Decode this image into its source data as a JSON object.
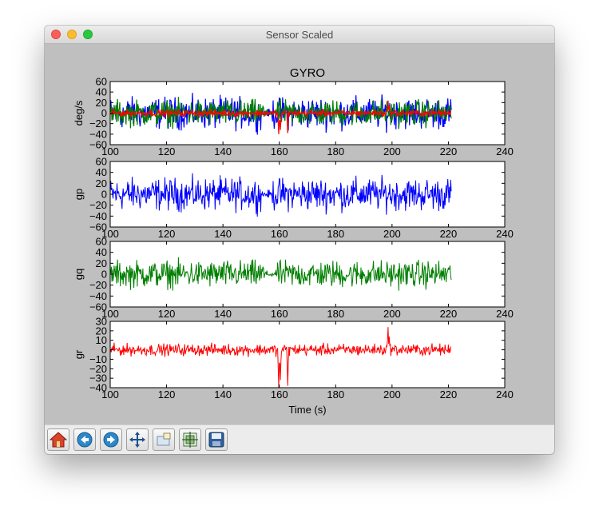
{
  "window": {
    "title": "Sensor Scaled"
  },
  "figure": {
    "title": "GYRO",
    "xlabel": "Time (s)"
  },
  "toolbar": {
    "buttons": [
      {
        "name": "home-button",
        "icon": "home-icon"
      },
      {
        "name": "back-button",
        "icon": "back-arrow-icon"
      },
      {
        "name": "forward-button",
        "icon": "forward-arrow-icon"
      },
      {
        "name": "pan-button",
        "icon": "pan-arrows-icon"
      },
      {
        "name": "zoom-button",
        "icon": "zoom-rect-icon"
      },
      {
        "name": "subplots-button",
        "icon": "subplots-config-icon"
      },
      {
        "name": "save-button",
        "icon": "save-disk-icon"
      }
    ]
  },
  "colors": {
    "p": "#0000ff",
    "q": "#007f00",
    "r": "#ff0000",
    "figure_bg": "#bfbfbf",
    "axes_bg": "#ffffff"
  },
  "chart_data": [
    {
      "type": "line",
      "ylabel": "deg/s",
      "xlim": [
        100,
        240
      ],
      "ylim": [
        -60,
        60
      ],
      "xticks": [
        "100",
        "120",
        "140",
        "160",
        "180",
        "200",
        "220",
        "240"
      ],
      "yticks": [
        "60",
        "40",
        "20",
        "0",
        "−20",
        "−40",
        "−60"
      ],
      "series": [
        {
          "color": "#0000ff",
          "key": "p"
        },
        {
          "color": "#007f00",
          "key": "q"
        },
        {
          "color": "#ff0000",
          "key": "r"
        }
      ]
    },
    {
      "type": "line",
      "ylabel": "gp",
      "xlim": [
        100,
        240
      ],
      "ylim": [
        -60,
        60
      ],
      "xticks": [
        "100",
        "120",
        "140",
        "160",
        "180",
        "200",
        "220",
        "240"
      ],
      "yticks": [
        "60",
        "40",
        "20",
        "0",
        "−20",
        "−40",
        "−60"
      ],
      "series": [
        {
          "color": "#0000ff",
          "key": "p"
        }
      ]
    },
    {
      "type": "line",
      "ylabel": "gq",
      "xlim": [
        100,
        240
      ],
      "ylim": [
        -60,
        60
      ],
      "xticks": [
        "100",
        "120",
        "140",
        "160",
        "180",
        "200",
        "220",
        "240"
      ],
      "yticks": [
        "60",
        "40",
        "20",
        "0",
        "−20",
        "−40",
        "−60"
      ],
      "series": [
        {
          "color": "#007f00",
          "key": "q"
        }
      ]
    },
    {
      "type": "line",
      "ylabel": "gr",
      "xlim": [
        100,
        240
      ],
      "ylim": [
        -40,
        30
      ],
      "xticks": [
        "100",
        "120",
        "140",
        "160",
        "180",
        "200",
        "220",
        "240"
      ],
      "yticks": [
        "30",
        "20",
        "10",
        "0",
        "−10",
        "−20",
        "−30",
        "−40"
      ],
      "series": [
        {
          "color": "#ff0000",
          "key": "r"
        }
      ]
    }
  ],
  "signals": {
    "x_start": 100,
    "x_end": 221,
    "p": {
      "amplitude": 22,
      "spread": 48,
      "quiet": [
        [
          153.5,
          157.5
        ]
      ]
    },
    "q": {
      "amplitude": 18,
      "spread": 40,
      "quiet": [
        [
          155,
          159
        ]
      ]
    },
    "r": {
      "amplitude": 4,
      "spread": 10,
      "quiet": [],
      "events": [
        {
          "x": 159.8,
          "y": -40
        },
        {
          "x": 160.4,
          "y": -32
        },
        {
          "x": 163.0,
          "y": -38
        },
        {
          "x": 198.6,
          "y": 24
        },
        {
          "x": 199.0,
          "y": 14
        }
      ]
    }
  }
}
